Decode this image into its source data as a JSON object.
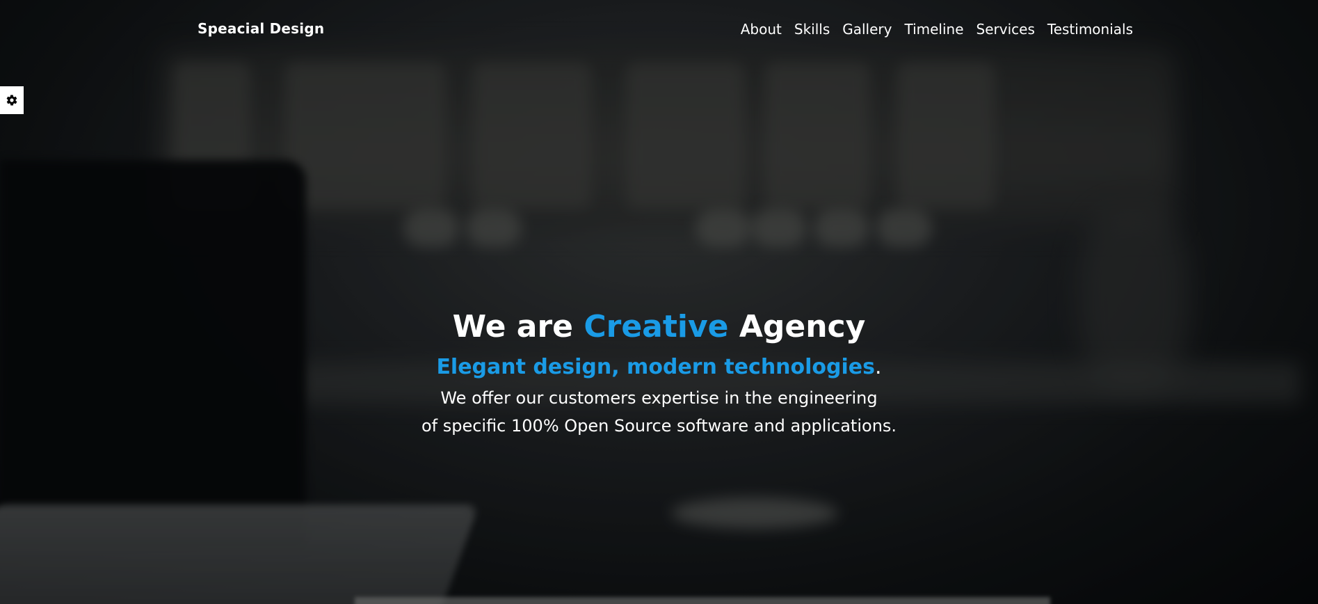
{
  "brand": {
    "name": "Speacial Design"
  },
  "nav": {
    "items": [
      {
        "label": "About"
      },
      {
        "label": "Skills"
      },
      {
        "label": "Gallery"
      },
      {
        "label": "Timeline"
      },
      {
        "label": "Services"
      },
      {
        "label": "Testimonials"
      }
    ]
  },
  "settings": {
    "icon": "gear-icon"
  },
  "hero": {
    "headline_pre": "We are",
    "headline_accent": "Creative",
    "headline_post": "Agency",
    "subhead_accent": "Elegant design, modern technologies",
    "subhead_end": ".",
    "description_line1": "We offer our customers expertise in the engineering",
    "description_line2": "of specific 100% Open Source software and applications."
  },
  "colors": {
    "accent": "#1a9be6",
    "text": "#ffffff",
    "settings_bg": "#ffffff"
  }
}
